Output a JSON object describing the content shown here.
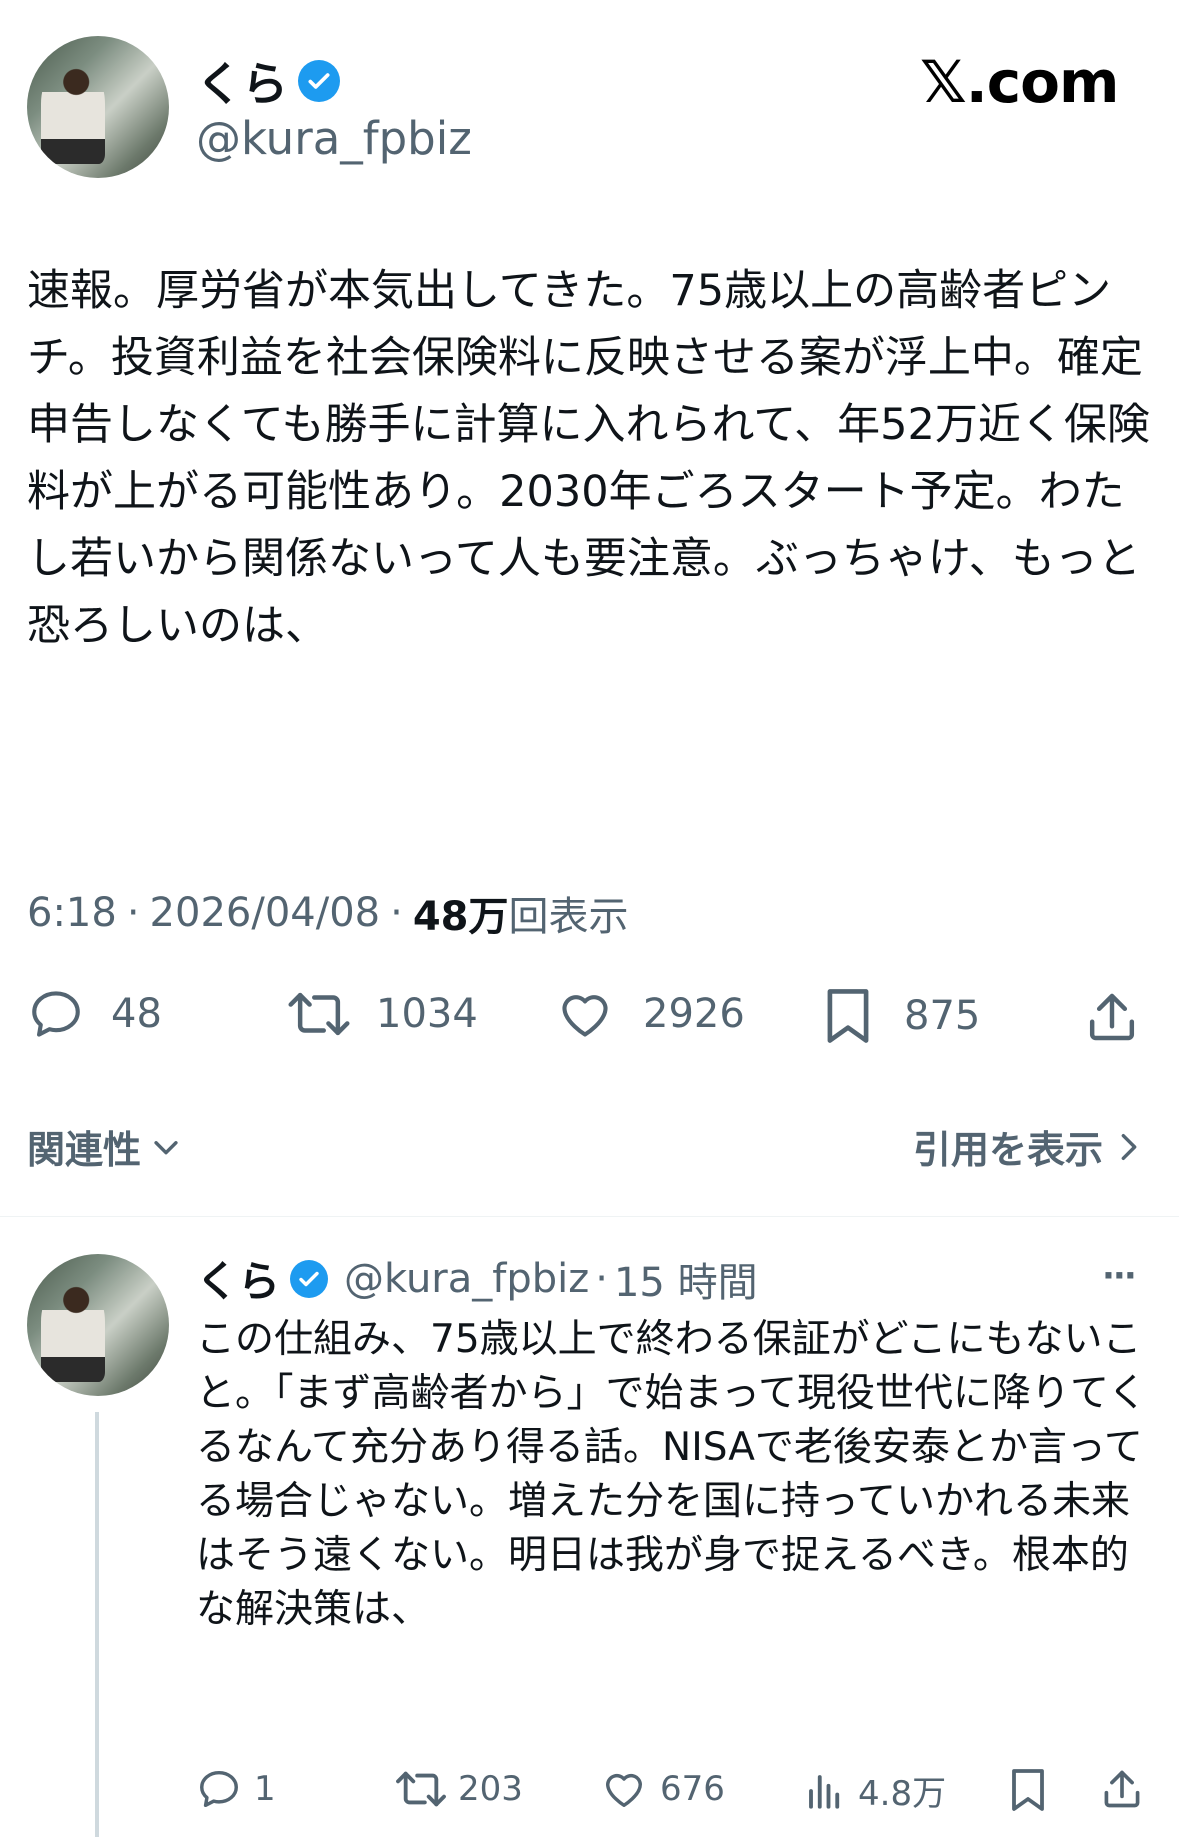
{
  "main_tweet": {
    "display_name": "くら",
    "handle": "@kura_fpbiz",
    "site_logo": "𝕏.com",
    "text": "速報。厚労省が本気出してきた。75歳以上の高齢者ピンチ。投資利益を社会保険料に反映させる案が浮上中。確定申告しなくても勝手に計算に入れられて、年52万近く保険料が上がる可能性あり。2030年ごろスタート予定。わたし若いから関係ないって人も要注意。ぶっちゃけ、もっと恐ろしいのは、",
    "time": "6:18",
    "date": "2026/04/08",
    "views_count": "48万",
    "views_label": "回表示",
    "replies": "48",
    "reposts": "1034",
    "likes": "2926",
    "bookmarks": "875",
    "sort_label": "関連性",
    "quotes_label": "引用を表示"
  },
  "reply_tweet": {
    "display_name": "くら",
    "handle": "@kura_fpbiz",
    "time_ago": "15 時間",
    "more": "···",
    "text": "この仕組み、75歳以上で終わる保証がどこにもないこと。「まず高齢者から」で始まって現役世代に降りてくるなんて充分あり得る話。NISAで老後安泰とか言ってる場合じゃない。増えた分を国に持っていかれる未来はそう遠くない。明日は我が身で捉えるべき。根本的な解決策は、",
    "replies": "1",
    "reposts": "203",
    "likes": "676",
    "views": "4.8万"
  },
  "icons": [
    "verified-badge-icon",
    "reply-icon",
    "repost-icon",
    "like-icon",
    "bookmark-icon",
    "share-icon",
    "chevron-down-icon",
    "chevron-right-icon",
    "views-icon",
    "more-icon"
  ],
  "colors": {
    "verified": "#1d9bf0",
    "muted": "#536471",
    "text": "#0f1419"
  }
}
